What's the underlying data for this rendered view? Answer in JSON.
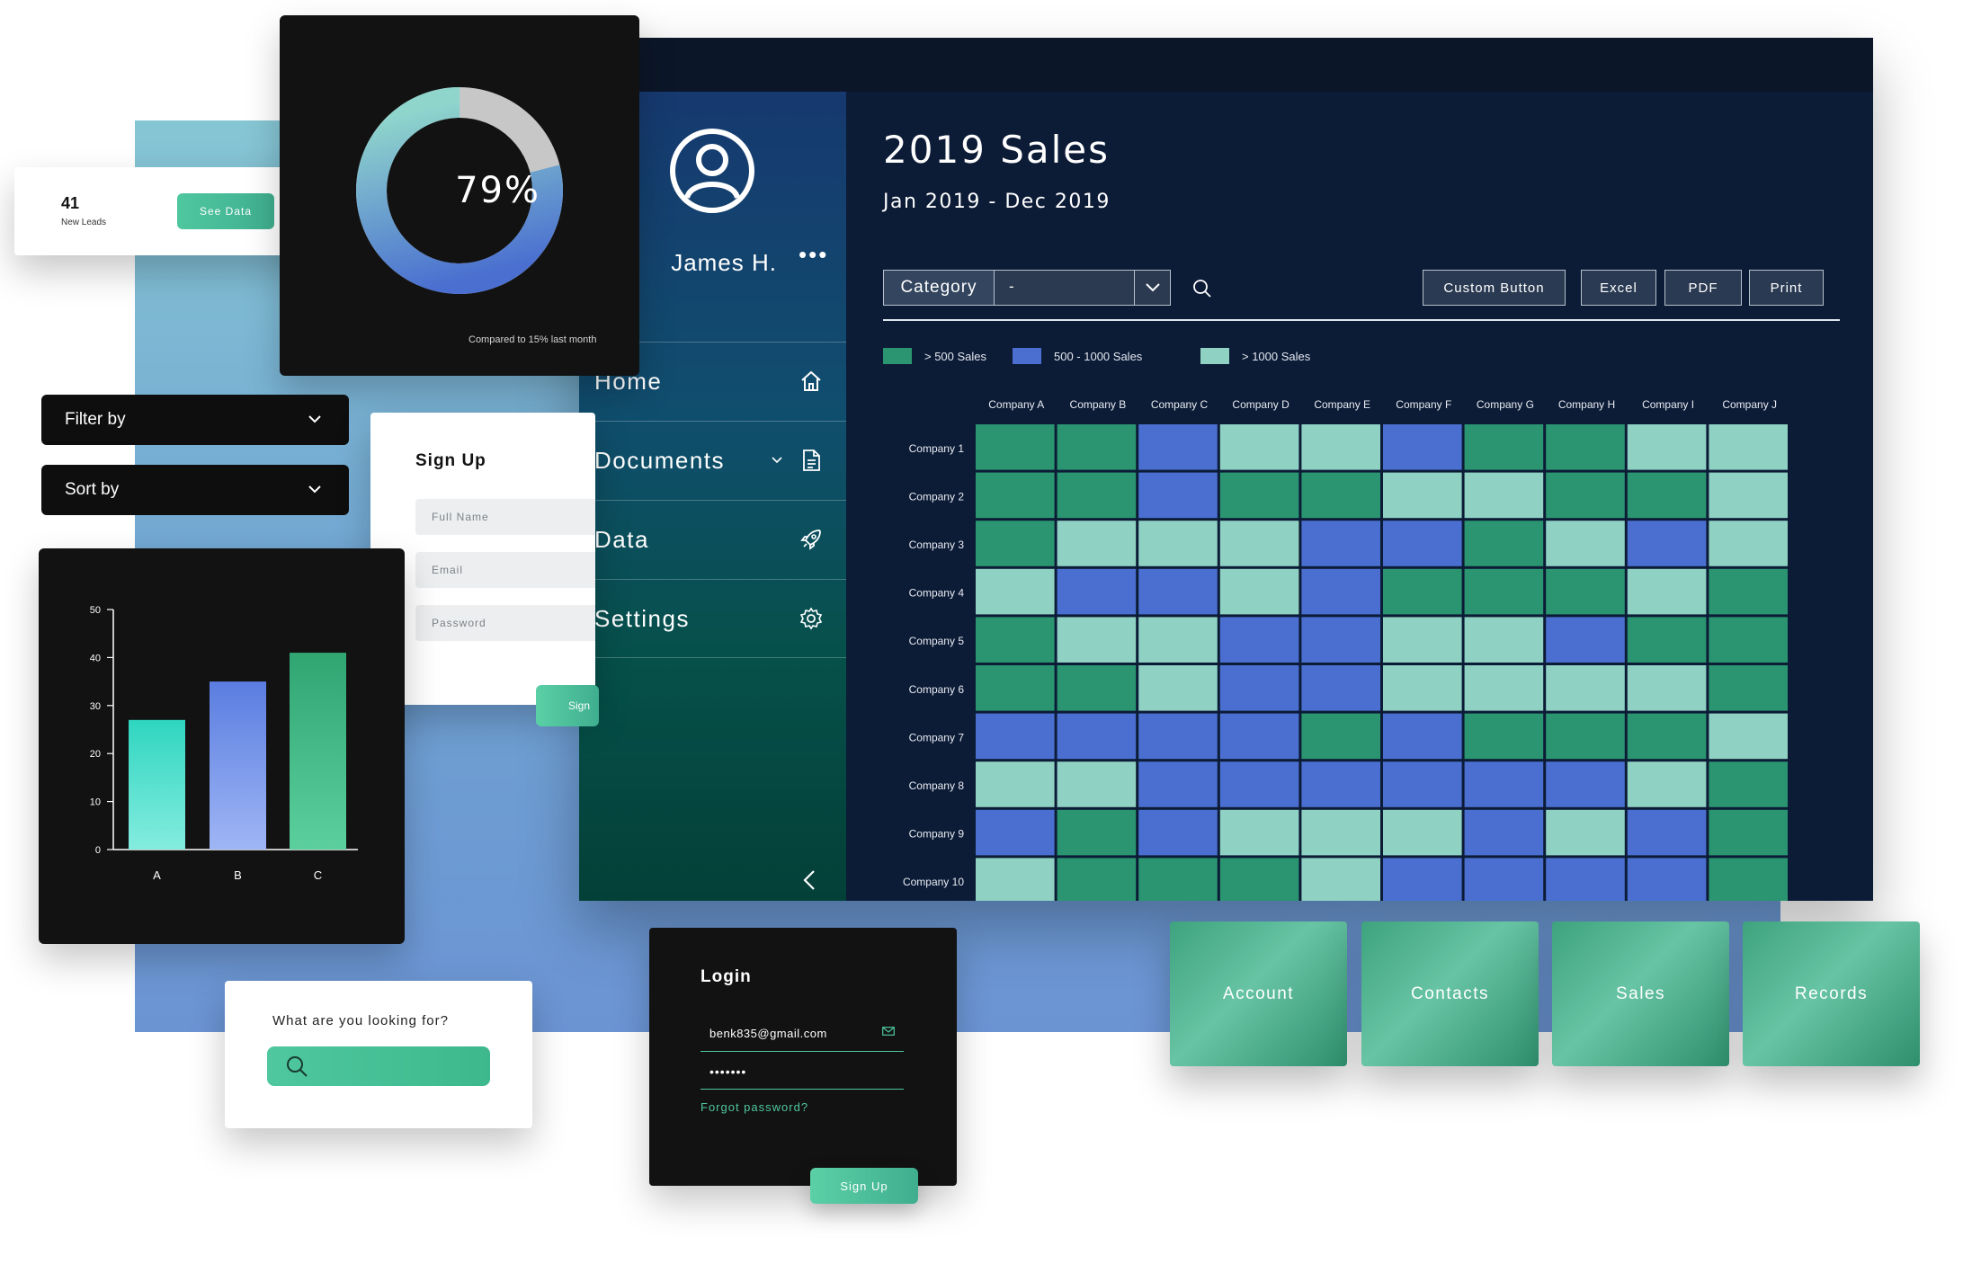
{
  "colors": {
    "green": "#2a9570",
    "blue": "#4a6fd0",
    "light": "#8fd1c3",
    "accent": "#4fc79f"
  },
  "dashboard": {
    "user_name": "James H.",
    "user_menu": "•••",
    "nav": [
      {
        "label": "Home",
        "icon": "home-icon"
      },
      {
        "label": "Documents",
        "icon": "document-icon"
      },
      {
        "label": "Data",
        "icon": "rocket-icon"
      },
      {
        "label": "Settings",
        "icon": "gear-icon"
      }
    ],
    "title": "2019 Sales",
    "subtitle": "Jan 2019 - Dec 2019",
    "category_label": "Category",
    "category_value": "-",
    "buttons": [
      "Custom Button",
      "Excel",
      "PDF",
      "Print"
    ],
    "legend": [
      {
        "label": "> 500 Sales",
        "color": "#2a9570"
      },
      {
        "label": "500 - 1000 Sales",
        "color": "#4a6fd0"
      },
      {
        "label": "> 1000 Sales",
        "color": "#8fd1c3"
      }
    ]
  },
  "chart_data": [
    {
      "type": "heatmap",
      "columns": [
        "Company A",
        "Company B",
        "Company C",
        "Company D",
        "Company E",
        "Company F",
        "Company G",
        "Company H",
        "Company I",
        "Company J"
      ],
      "rows": [
        "Company 1",
        "Company 2",
        "Company 3",
        "Company 4",
        "Company 5",
        "Company 6",
        "Company 7",
        "Company 8",
        "Company 9",
        "Company 10"
      ],
      "legend": [
        "> 500 Sales",
        "500 - 1000 Sales",
        "> 1000 Sales"
      ],
      "values": [
        [
          0,
          0,
          1,
          2,
          2,
          1,
          0,
          0,
          2,
          2
        ],
        [
          0,
          0,
          1,
          0,
          0,
          2,
          2,
          0,
          0,
          2
        ],
        [
          0,
          2,
          2,
          2,
          1,
          1,
          0,
          2,
          1,
          2
        ],
        [
          2,
          1,
          1,
          2,
          1,
          0,
          0,
          0,
          2,
          0
        ],
        [
          0,
          2,
          2,
          1,
          1,
          2,
          2,
          1,
          0,
          0
        ],
        [
          0,
          0,
          2,
          1,
          1,
          2,
          2,
          2,
          2,
          0
        ],
        [
          1,
          1,
          1,
          1,
          0,
          1,
          0,
          0,
          0,
          2
        ],
        [
          2,
          2,
          1,
          1,
          1,
          1,
          1,
          1,
          2,
          0
        ],
        [
          1,
          0,
          1,
          2,
          2,
          2,
          1,
          2,
          1,
          0
        ],
        [
          2,
          0,
          0,
          0,
          2,
          1,
          1,
          1,
          1,
          0
        ]
      ]
    },
    {
      "type": "bar",
      "categories": [
        "A",
        "B",
        "C"
      ],
      "values": [
        27,
        35,
        41
      ],
      "ylim": [
        0,
        50
      ],
      "yticks": [
        0,
        10,
        20,
        30,
        40,
        50
      ]
    },
    {
      "type": "pie",
      "label": "79%",
      "values": [
        79,
        21
      ]
    }
  ],
  "leads": {
    "count": "41",
    "label": "New Leads",
    "button": "See Data"
  },
  "donut": {
    "value": "79%",
    "note": "Compared to 15% last month"
  },
  "filters": {
    "filter_label": "Filter by",
    "sort_label": "Sort by"
  },
  "signup": {
    "title": "Sign Up",
    "full_name": "Full Name",
    "email": "Email",
    "password": "Password",
    "button": "Sign Up"
  },
  "search": {
    "question": "What are you looking for?"
  },
  "login": {
    "title": "Login",
    "email": "benk835@gmail.com",
    "password": "•••••••",
    "forgot": "Forgot password?",
    "button": "Sign Up"
  },
  "tiles": [
    "Account",
    "Contacts",
    "Sales",
    "Records"
  ]
}
